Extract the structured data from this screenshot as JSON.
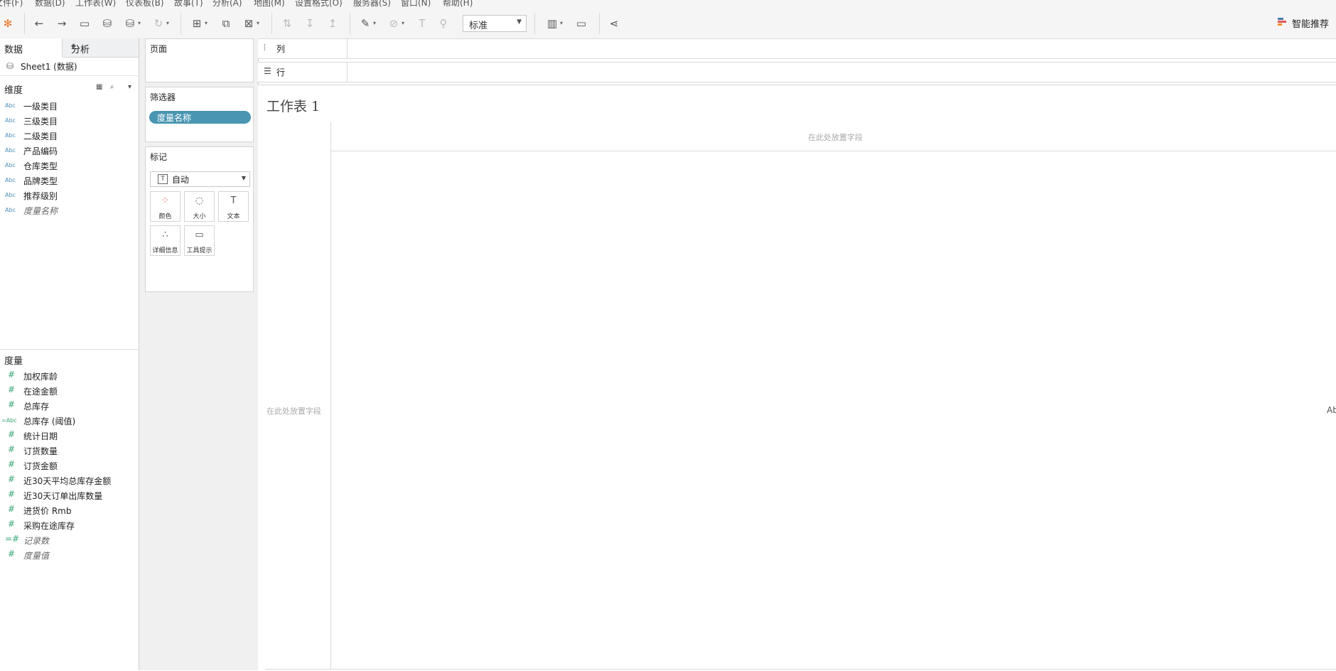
{
  "menu": [
    "文件(F)",
    "数据(D)",
    "工作表(W)",
    "仪表板(B)",
    "故事(T)",
    "分析(A)",
    "地图(M)",
    "设置格式(O)",
    "服务器(S)",
    "窗口(N)",
    "帮助(H)"
  ],
  "toolbar": {
    "fit_value": "标准",
    "show_me_label": "智能推荐"
  },
  "left_pane": {
    "tab_data": "数据",
    "tab_analysis": "分析",
    "datasource": "Sheet1 (数据)",
    "dimensions_header": "维度",
    "dimensions": [
      {
        "type": "Abc",
        "name": "一级类目"
      },
      {
        "type": "Abc",
        "name": "三级类目"
      },
      {
        "type": "Abc",
        "name": "二级类目"
      },
      {
        "type": "Abc",
        "name": "产品编码"
      },
      {
        "type": "Abc",
        "name": "仓库类型"
      },
      {
        "type": "Abc",
        "name": "品牌类型"
      },
      {
        "type": "Abc",
        "name": "推荐级别"
      },
      {
        "type": "Abc",
        "name": "度量名称"
      }
    ],
    "measures_header": "度量",
    "measures": [
      {
        "type": "#",
        "name": "加权库龄"
      },
      {
        "type": "#",
        "name": "在途金额"
      },
      {
        "type": "#",
        "name": "总库存"
      },
      {
        "type": "=Abc",
        "name": "总库存 (阈值)"
      },
      {
        "type": "#",
        "name": "统计日期"
      },
      {
        "type": "#",
        "name": "订货数量"
      },
      {
        "type": "#",
        "name": "订货金额"
      },
      {
        "type": "#",
        "name": "近30天平均总库存金额"
      },
      {
        "type": "#",
        "name": "近30天订单出库数量"
      },
      {
        "type": "#",
        "name": "进货价 Rmb"
      },
      {
        "type": "#",
        "name": "采购在途库存"
      },
      {
        "type": "=#",
        "name": "记录数"
      },
      {
        "type": "#",
        "name": "度量值"
      }
    ]
  },
  "cards": {
    "pages_title": "页面",
    "filters_title": "筛选器",
    "filter_pill": "度量名称",
    "marks_title": "标记",
    "mark_type": "自动",
    "mark_buttons": {
      "color": "颜色",
      "size": "大小",
      "text": "文本",
      "detail": "详细信息",
      "tooltip": "工具提示"
    }
  },
  "shelves": {
    "columns": "列",
    "rows": "行"
  },
  "view": {
    "sheet_title": "工作表 1",
    "drop_field_top": "在此处放置字段",
    "drop_field_left": "在此处放置字段",
    "abc_placeholder": "Ab"
  },
  "colors": {
    "pill": "#4996b2",
    "dimension_icon": "#4a8fbd",
    "measure_icon": "#3aa677"
  }
}
